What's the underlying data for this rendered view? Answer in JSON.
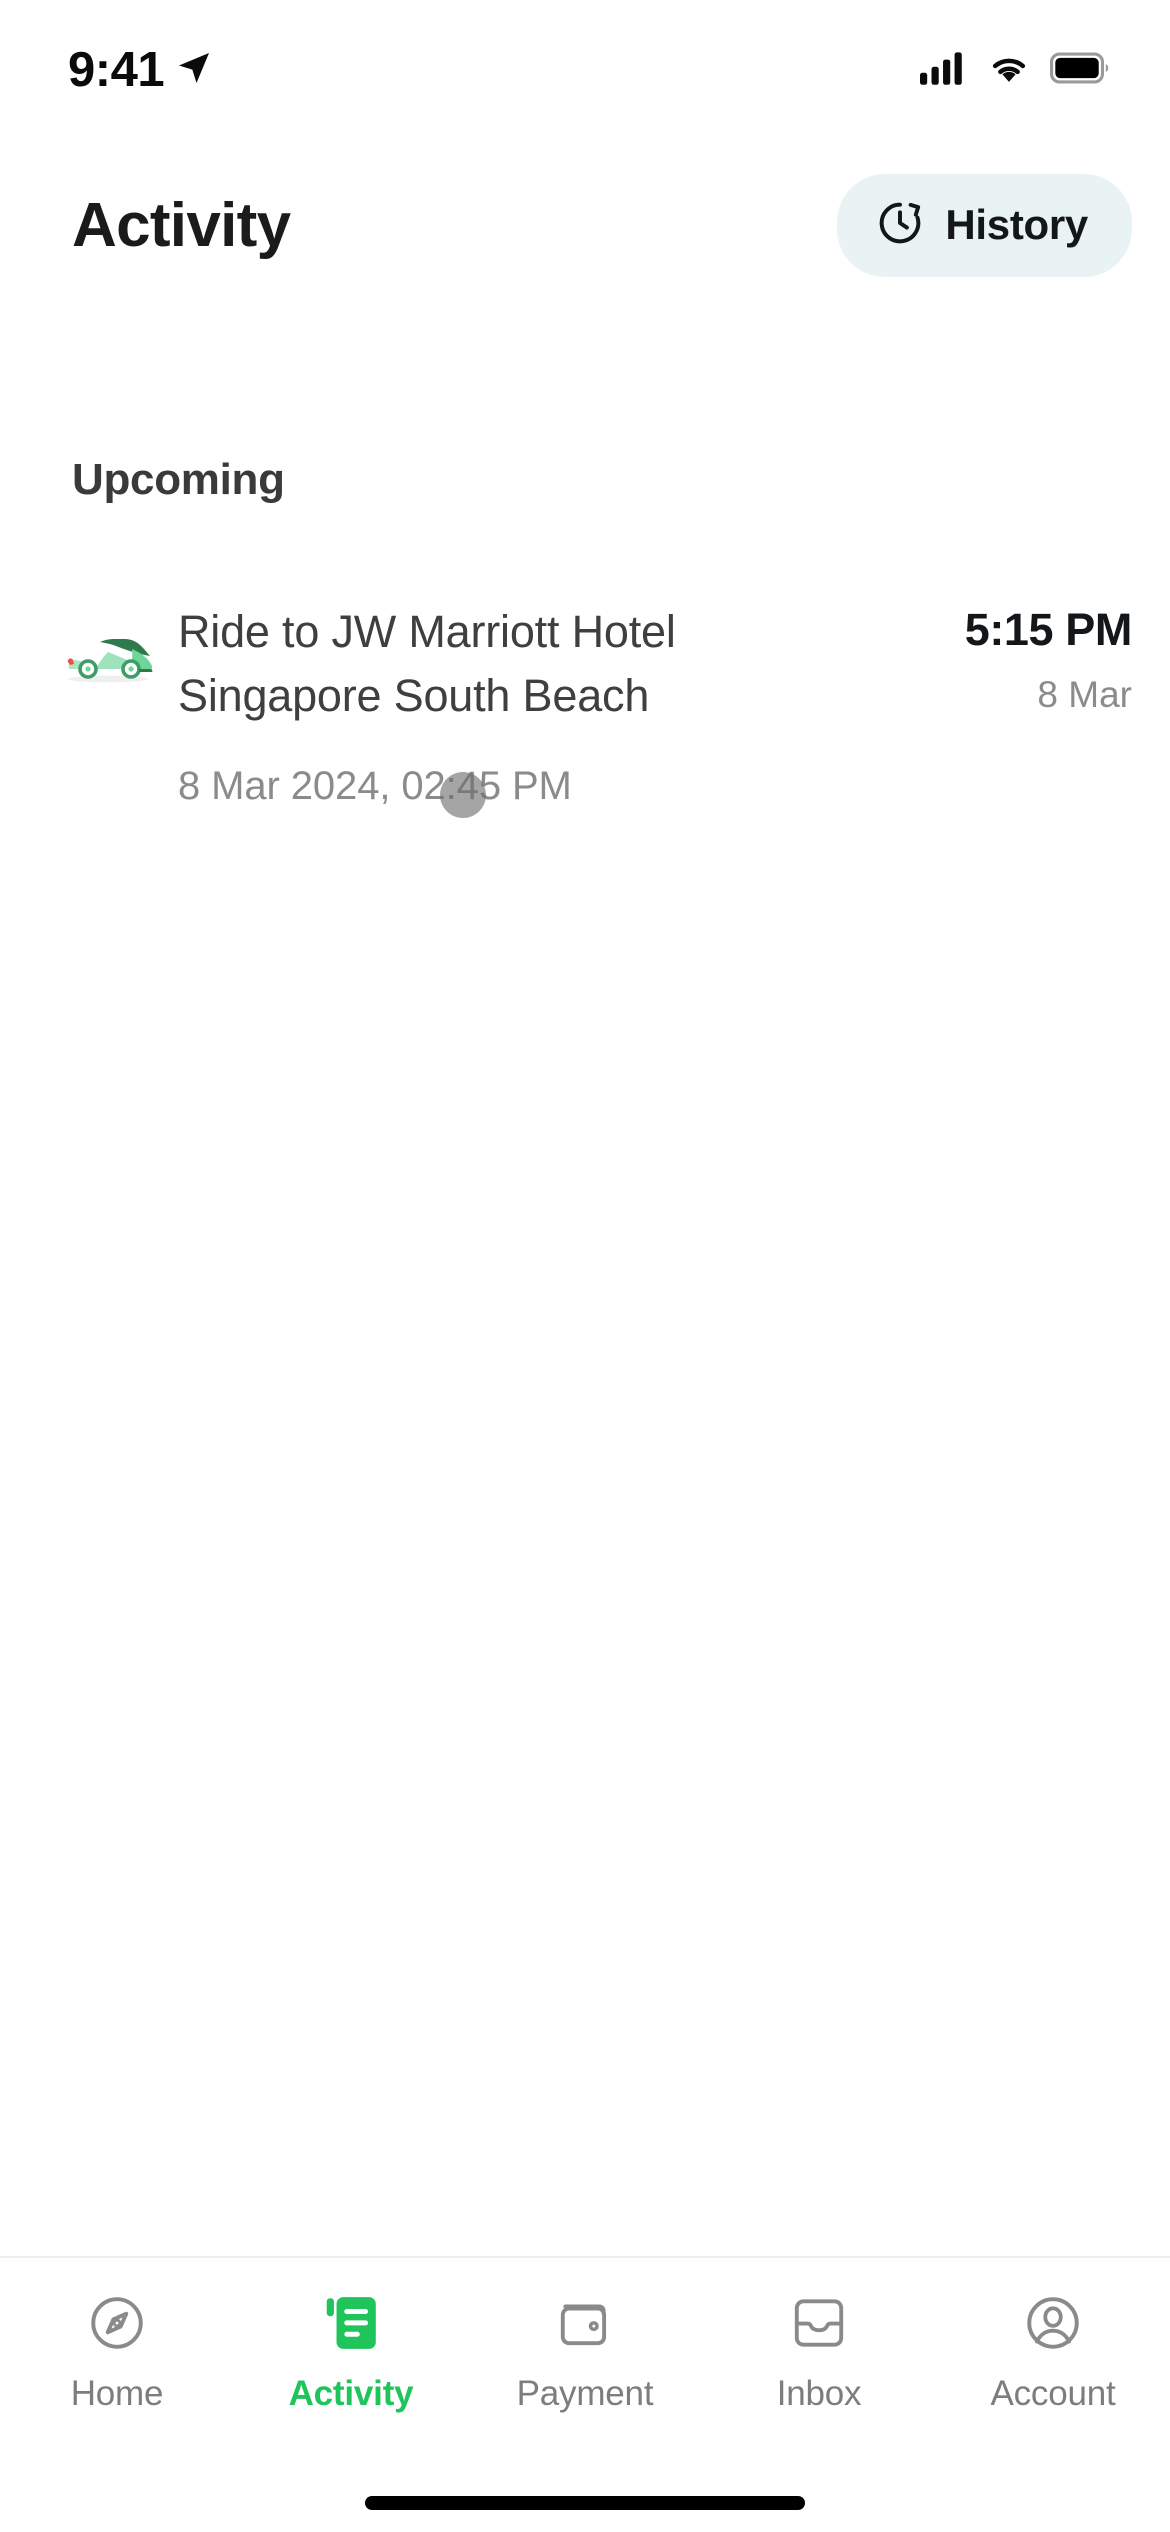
{
  "status_bar": {
    "time": "9:41",
    "location_icon": "location-arrow-icon",
    "cellular_icon": "cellular-signal-icon",
    "wifi_icon": "wifi-icon",
    "battery_icon": "battery-full-icon"
  },
  "header": {
    "title": "Activity",
    "history_button": {
      "label": "History",
      "icon": "clock-history-icon",
      "background_color": "#e9f3f3"
    }
  },
  "main": {
    "section_title": "Upcoming",
    "rides": [
      {
        "icon": "green-car-icon",
        "title": "Ride to JW Marriott Hotel Singapore South Beach",
        "subtitle": "8 Mar 2024, 02:45 PM",
        "time": "5:15 PM",
        "date": "8 Mar"
      }
    ]
  },
  "touch_indicator": {
    "name": "touch-point-indicator",
    "color": "#6e6e6e"
  },
  "bottom_nav": {
    "active_color": "#1fc45a",
    "inactive_color": "#7d7d7d",
    "items": [
      {
        "label": "Home",
        "icon": "compass-icon",
        "active": false
      },
      {
        "label": "Activity",
        "icon": "document-list-icon",
        "active": true
      },
      {
        "label": "Payment",
        "icon": "wallet-icon",
        "active": false
      },
      {
        "label": "Inbox",
        "icon": "inbox-tray-icon",
        "active": false
      },
      {
        "label": "Account",
        "icon": "person-circle-icon",
        "active": false
      }
    ]
  },
  "home_indicator": {
    "name": "home-indicator"
  }
}
